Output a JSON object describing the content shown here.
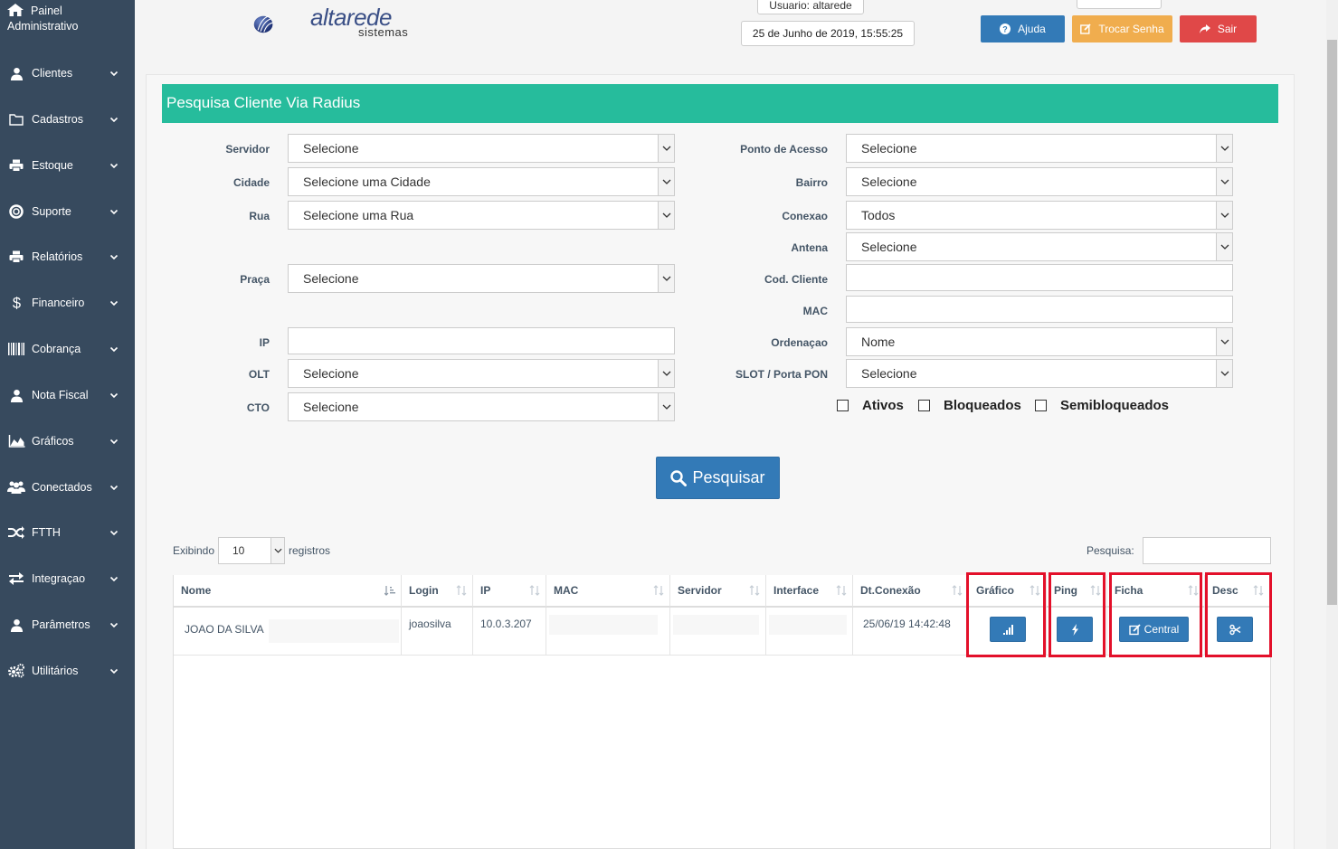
{
  "sidebar": {
    "brand_line1": "Painel",
    "brand_line2": "Administrativo",
    "items": [
      {
        "label": "Clientes",
        "icon": "user-icon"
      },
      {
        "label": "Cadastros",
        "icon": "folder-icon"
      },
      {
        "label": "Estoque",
        "icon": "printer-icon"
      },
      {
        "label": "Suporte",
        "icon": "lifebuoy-icon"
      },
      {
        "label": "Relatórios",
        "icon": "printer-icon"
      },
      {
        "label": "Financeiro",
        "icon": "dollar-icon"
      },
      {
        "label": "Cobrança",
        "icon": "barcode-icon"
      },
      {
        "label": "Nota Fiscal",
        "icon": "user-icon"
      },
      {
        "label": "Gráficos",
        "icon": "area-chart-icon"
      },
      {
        "label": "Conectados",
        "icon": "users-icon"
      },
      {
        "label": "FTTH",
        "icon": "random-icon"
      },
      {
        "label": "Integraçao",
        "icon": "exchange-icon"
      },
      {
        "label": "Parâmetros",
        "icon": "user-icon"
      },
      {
        "label": "Utilitários",
        "icon": "cogs-icon"
      }
    ]
  },
  "header": {
    "logo_text": "altarede",
    "logo_sub": "sistemas",
    "user": "Usuario: altarede",
    "small_box": " ",
    "date": "25 de Junho de 2019, 15:55:25",
    "help_label": "Ajuda",
    "change_password_label": "Trocar Senha",
    "exit_label": "Sair"
  },
  "form": {
    "title": "Pesquisa Cliente Via Radius",
    "servidor_label": "Servidor",
    "servidor_value": "Selecione",
    "cidade_label": "Cidade",
    "cidade_value": "Selecione uma Cidade",
    "rua_label": "Rua",
    "rua_value": "Selecione uma Rua",
    "praca_label": "Praça",
    "praca_value": "Selecione",
    "ip_label": "IP",
    "olt_label": "OLT",
    "olt_value": "Selecione",
    "cto_label": "CTO",
    "cto_value": "Selecione",
    "ponto_label": "Ponto de Acesso",
    "ponto_value": "Selecione",
    "bairro_label": "Bairro",
    "bairro_value": "Selecione",
    "conexao_label": "Conexao",
    "conexao_value": "Todos",
    "antena_label": "Antena",
    "antena_value": "Selecione",
    "cod_label": "Cod. Cliente",
    "mac_label": "MAC",
    "ordenacao_label": "Ordenaçao",
    "ordenacao_value": "Nome",
    "slot_label": "SLOT / Porta PON",
    "slot_value": "Selecione",
    "ativos_label": "Ativos",
    "bloqueados_label": "Bloqueados",
    "semibloqueados_label": "Semibloqueados",
    "search_button": "Pesquisar"
  },
  "table": {
    "show_label": "Exibindo",
    "page_size": "10",
    "records_label": "registros",
    "search_label": "Pesquisa:",
    "columns": [
      "Nome",
      "Login",
      "IP",
      "MAC",
      "Servidor",
      "Interface",
      "Dt.Conexão",
      "Gráfico",
      "Ping",
      "Ficha",
      "Desc"
    ],
    "rows": [
      {
        "nome": "JOAO DA SILVA",
        "login": "joaosilva",
        "ip": "10.0.3.207",
        "mac": "",
        "servidor": "",
        "interface": "",
        "dt": "25/06/19 14:42:48",
        "ficha_button": "Central"
      }
    ]
  },
  "colors": {
    "sidebar_bg": "#374a5e",
    "title_bar": "#26bc9c",
    "primary": "#337ab7",
    "warning": "#f0ad4e",
    "danger": "#e04848",
    "highlight": "#e3102a"
  }
}
